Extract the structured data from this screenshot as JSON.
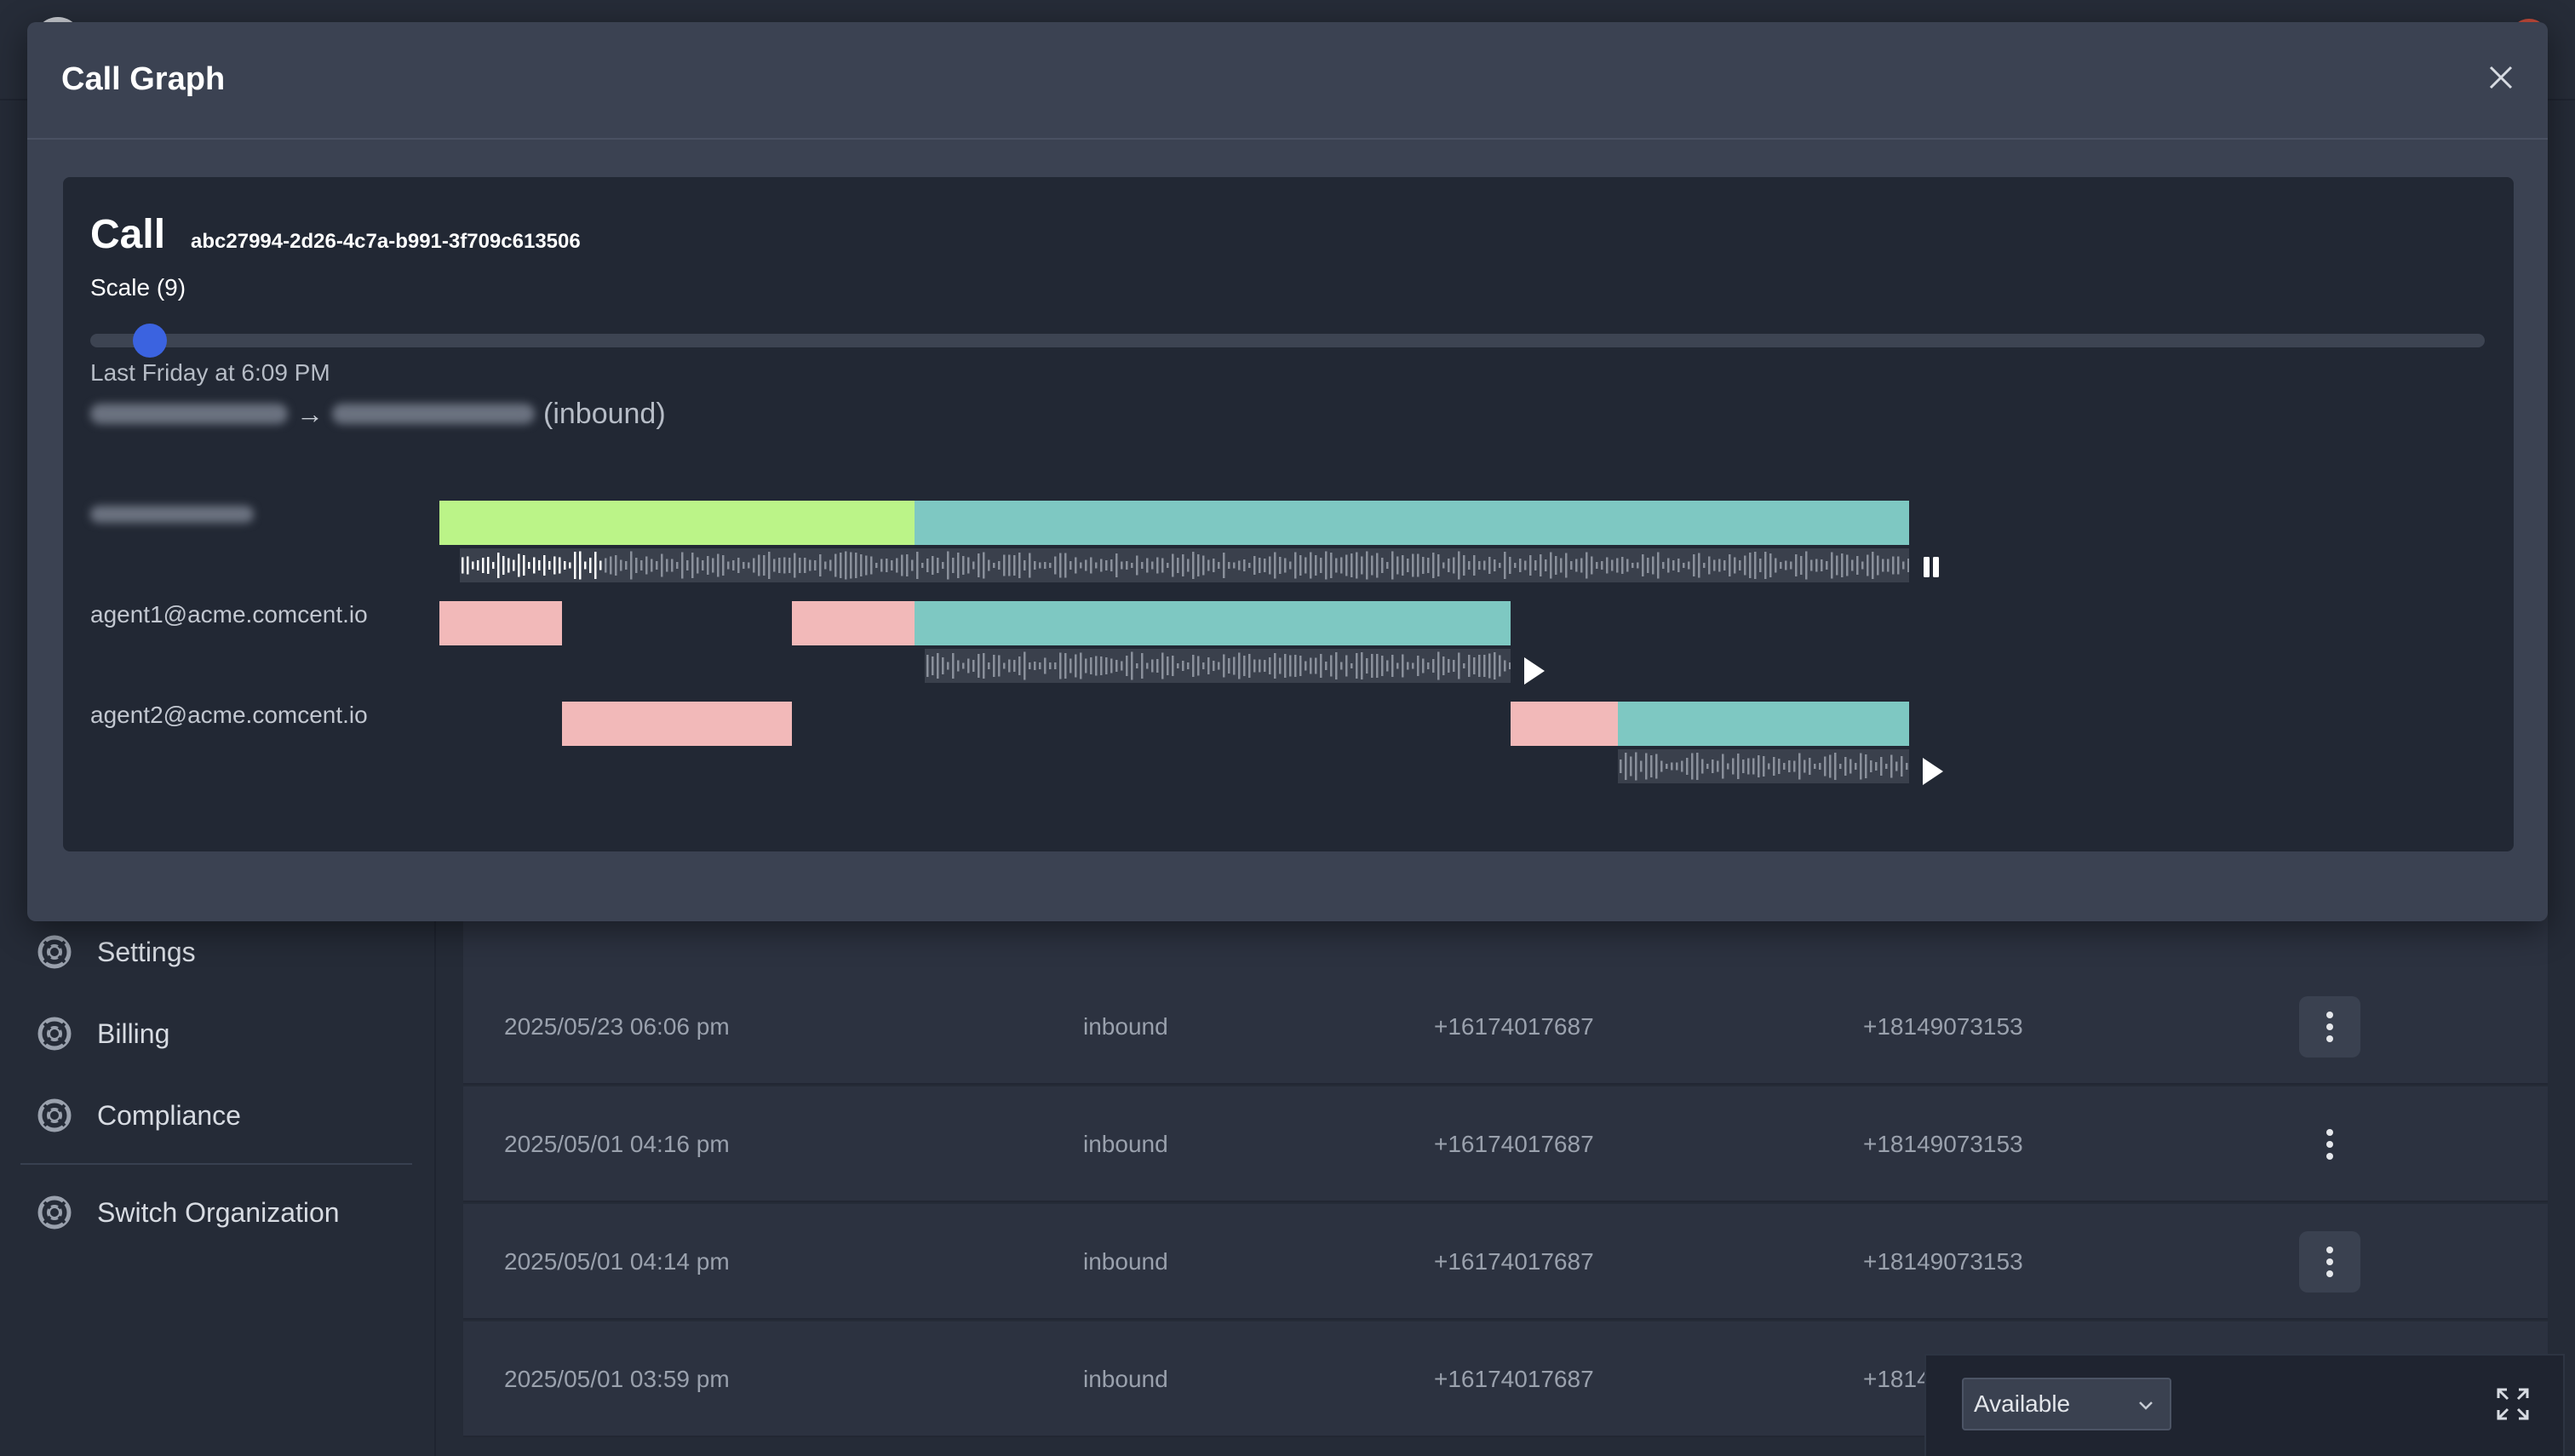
{
  "app": {
    "sidebar": {
      "items": [
        {
          "label": "Settings",
          "icon": "lifebuoy-icon"
        },
        {
          "label": "Billing",
          "icon": "lifebuoy-icon"
        },
        {
          "label": "Compliance",
          "icon": "lifebuoy-icon"
        },
        {
          "label": "Switch Organization",
          "icon": "lifebuoy-icon"
        }
      ]
    },
    "calls_table": {
      "rows": [
        {
          "date": "2025/05/23 06:06 pm",
          "direction": "inbound",
          "from": "+16174017687",
          "to": "+18149073153"
        },
        {
          "date": "2025/05/01 04:16 pm",
          "direction": "inbound",
          "from": "+16174017687",
          "to": "+18149073153"
        },
        {
          "date": "2025/05/01 04:14 pm",
          "direction": "inbound",
          "from": "+16174017687",
          "to": "+18149073153"
        },
        {
          "date": "2025/05/01 03:59 pm",
          "direction": "inbound",
          "from": "+16174017687",
          "to": "+1814"
        }
      ]
    },
    "status_widget": {
      "selected": "Available"
    }
  },
  "modal": {
    "title": "Call Graph",
    "call_label": "Call",
    "call_id": "abc27994-2d26-4c7a-b991-3f709c613506",
    "scale_label": "Scale (9)",
    "scale_value": 9,
    "call_time": "Last Friday at 6:09 PM",
    "direction_suffix": "(inbound)",
    "lanes": [
      {
        "label": "",
        "audio_state": "playing",
        "audio_icon": "pause-icon"
      },
      {
        "label": "agent1@acme.comcent.io",
        "audio_state": "paused",
        "audio_icon": "play-icon"
      },
      {
        "label": "agent2@acme.comcent.io",
        "audio_state": "paused",
        "audio_icon": "play-icon"
      }
    ],
    "segment_colors": {
      "playback_progress": "#bbf488",
      "talking": "#7ec8c2",
      "ringing": "#f2b9b9"
    }
  },
  "theme": {
    "background": "#252b37",
    "modal_bg": "#3b4252",
    "panel_bg": "#222834",
    "accent": "#3b63e0"
  }
}
